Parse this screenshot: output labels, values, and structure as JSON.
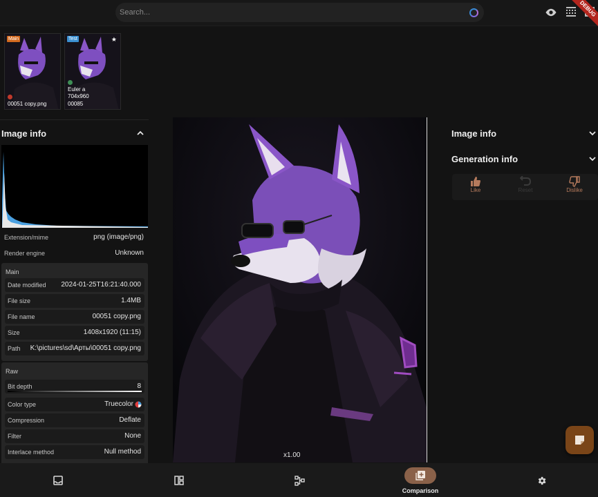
{
  "search": {
    "placeholder": "Search..."
  },
  "top_icons": [
    "eye-icon",
    "grid-dots-icon",
    "window-icon"
  ],
  "debug_label": "DEBUG",
  "thumbnails": [
    {
      "tag": "Main",
      "tag_color": "#d2691e",
      "dot_color": "#c0392b",
      "caption": "00051 copy.png"
    },
    {
      "tag": "Test",
      "tag_color": "#3a8fd0",
      "dot_color": "#3e8e55",
      "caption_line1": "Euler a",
      "caption_line2": "704x960",
      "caption_line3": "00085",
      "starred": true
    }
  ],
  "left_panel": {
    "title": "Image info",
    "rows": [
      {
        "key": "Extension/mime",
        "value": "png (image/png)"
      },
      {
        "key": "Render engine",
        "value": "Unknown"
      }
    ],
    "main_group": {
      "title": "Main",
      "rows": [
        {
          "key": "Date modified",
          "value": "2024-01-25T16:21:40.000"
        },
        {
          "key": "File size",
          "value": "1.4MB"
        },
        {
          "key": "File name",
          "value": "00051 copy.png"
        },
        {
          "key": "Size",
          "value": "1408x1920 (11:15)"
        },
        {
          "key": "Path",
          "value": "K:\\pictures\\sd\\Арты\\00051 copy.png"
        }
      ]
    },
    "raw_group": {
      "title": "Raw",
      "rows": [
        {
          "key": "Bit depth",
          "value": "8"
        },
        {
          "key": "Color type",
          "value": "Truecolor"
        },
        {
          "key": "Compression",
          "value": "Deflate"
        },
        {
          "key": "Filter",
          "value": "None"
        },
        {
          "key": "Interlace method",
          "value": "Null method"
        }
      ]
    }
  },
  "viewer": {
    "zoom": "x1.00"
  },
  "right_panel": {
    "sections": [
      "Image info",
      "Generation info"
    ],
    "rating": {
      "like": "Like",
      "reset": "Reset",
      "dislike": "Dislike"
    }
  },
  "colors": {
    "accent": "#8a6149",
    "fab": "#7a4518",
    "like": "#b57a5c"
  },
  "bottom_nav": [
    {
      "icon": "gallery-icon",
      "label": ""
    },
    {
      "icon": "dashboard-icon",
      "label": ""
    },
    {
      "icon": "graph-icon",
      "label": ""
    },
    {
      "icon": "comparison-icon",
      "label": "Comparison",
      "active": true
    },
    {
      "icon": "settings-icon",
      "label": ""
    }
  ]
}
